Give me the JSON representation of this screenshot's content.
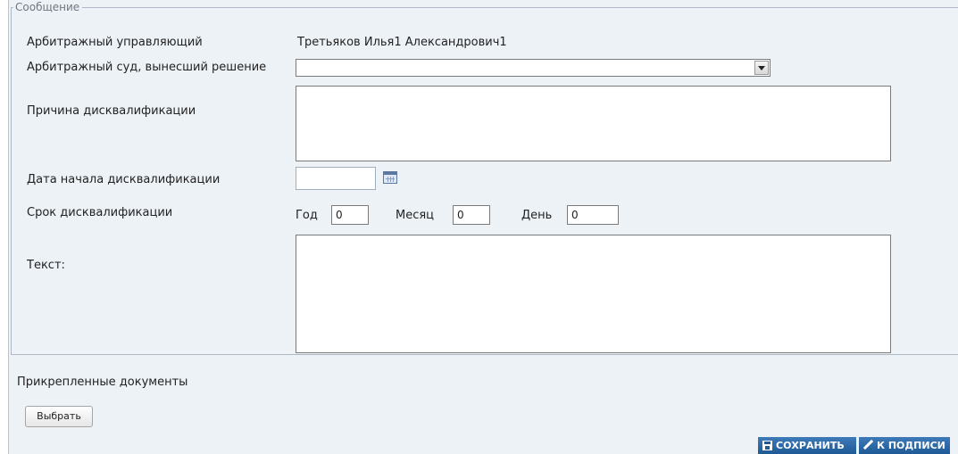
{
  "section_title": "Сообщение",
  "arbitration_manager": {
    "label": "Арбитражный управляющий",
    "value": "Третьяков Илья1 Александрович1"
  },
  "court": {
    "label": "Арбитражный суд, вынесший решение",
    "selected": ""
  },
  "reason": {
    "label": "Причина дисквалификации",
    "value": ""
  },
  "start_date": {
    "label": "Дата начала дисквалификации",
    "value": ""
  },
  "term": {
    "label": "Срок дисквалификации",
    "year_label": "Год",
    "year_value": "0",
    "month_label": "Месяц",
    "month_value": "0",
    "day_label": "День",
    "day_value": "0"
  },
  "text": {
    "label": "Текст:",
    "value": ""
  },
  "attachments": {
    "label": "Прикрепленные документы",
    "choose_button": "Выбрать"
  },
  "actions": {
    "save": "СОХРАНИТЬ",
    "to_sign": "К ПОДПИСИ"
  },
  "icons": {
    "dropdown": "chevron-down-icon",
    "calendar": "calendar-icon",
    "save": "floppy-disk-icon",
    "sign": "pen-icon"
  },
  "colors": {
    "panel_background": "#edf2f7",
    "action_button": "#1e5a96"
  }
}
